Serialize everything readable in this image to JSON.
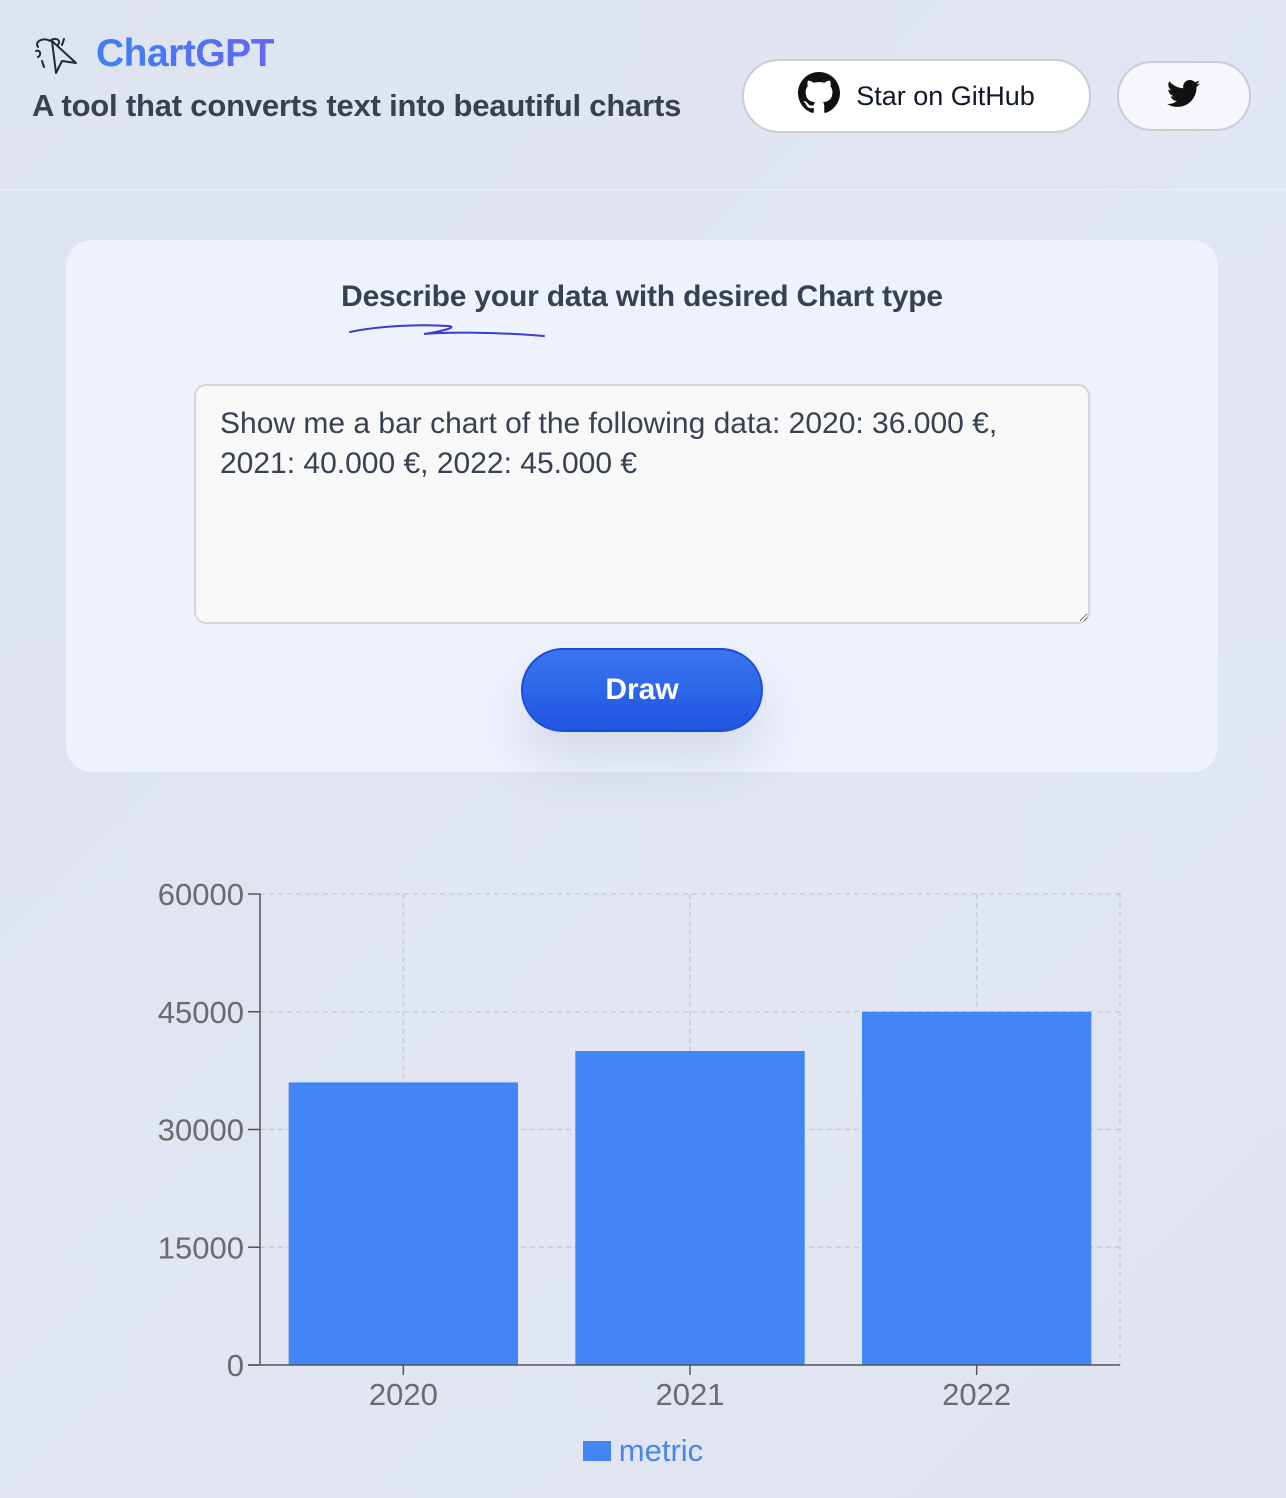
{
  "header": {
    "brand": "ChartGPT",
    "tagline": "A tool that converts text into beautiful charts",
    "github_label": "Star on GitHub",
    "logo_icon": "sketch-cursor-icon",
    "github_icon": "github-icon",
    "twitter_icon": "twitter-icon"
  },
  "form": {
    "title": "Describe your data with desired Chart type",
    "prompt_value": "Show me a bar chart of the following data: 2020: 36.000 €, 2021: 40.000 €, 2022: 45.000 €",
    "draw_label": "Draw"
  },
  "colors": {
    "accent": "#3b82f6",
    "bar": "#4285f4",
    "button": "#2563eb"
  },
  "chart_data": {
    "type": "bar",
    "categories": [
      "2020",
      "2021",
      "2022"
    ],
    "series": [
      {
        "name": "metric",
        "values": [
          36000,
          40000,
          45000
        ]
      }
    ],
    "yticks": [
      "0",
      "15000",
      "30000",
      "45000",
      "60000"
    ],
    "ylim": [
      0,
      60000
    ],
    "grid": true,
    "legend": "bottom-center"
  }
}
